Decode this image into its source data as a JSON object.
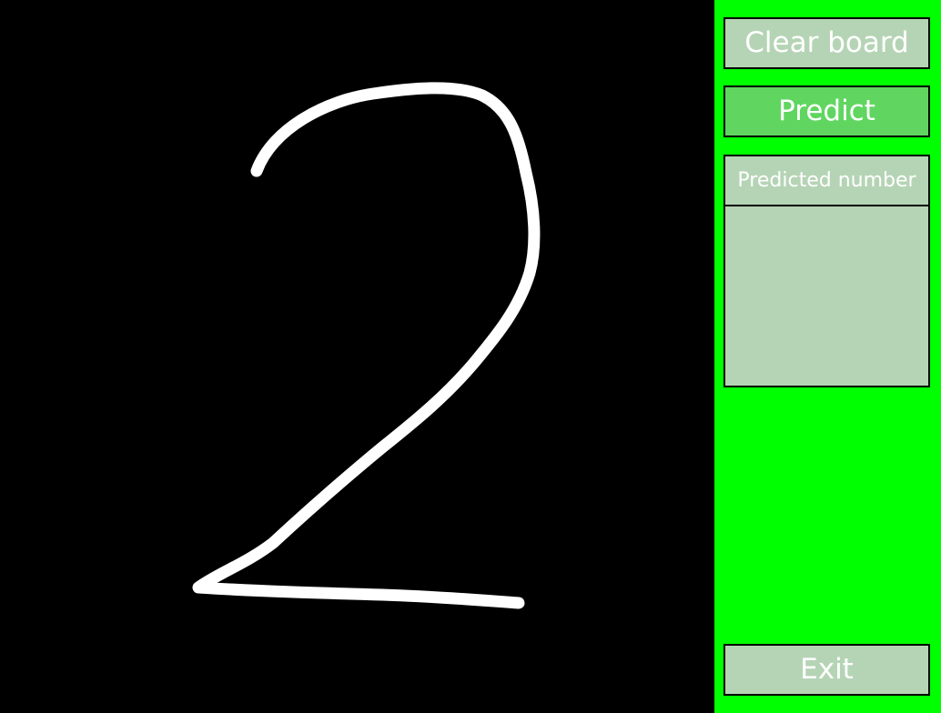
{
  "board": {
    "stroke_color": "#ffffff",
    "background_color": "#000000"
  },
  "panel": {
    "background_color": "#00ff00",
    "clear_label": "Clear board",
    "predict_label": "Predict",
    "predicted_header": "Predicted number",
    "predicted_value": "",
    "exit_label": "Exit"
  }
}
